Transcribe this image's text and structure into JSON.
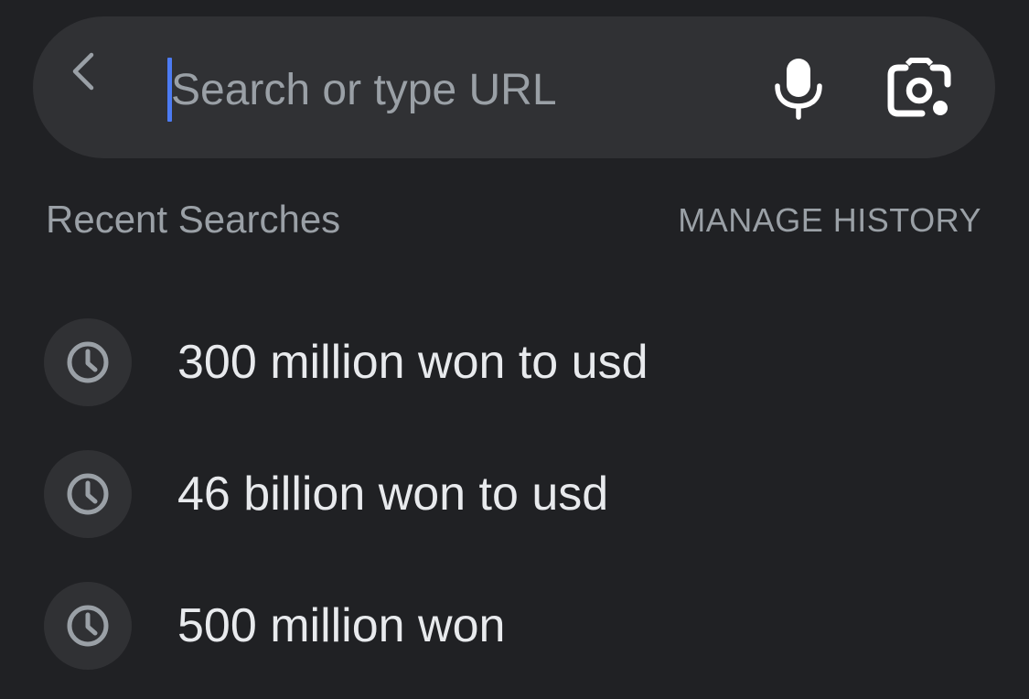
{
  "colors": {
    "background": "#202124",
    "surface": "#303134",
    "text_primary": "#e8eaed",
    "text_secondary": "#9aa0a6",
    "accent_cursor": "#4c7bf3"
  },
  "search_bar": {
    "back_icon": "chevron-left-icon",
    "placeholder": "Search or type URL",
    "value": "",
    "voice_icon": "microphone-icon",
    "lens_icon": "google-lens-icon"
  },
  "recent": {
    "title": "Recent Searches",
    "manage_label": "MANAGE HISTORY",
    "item_icon": "clock-icon",
    "items": [
      {
        "label": "300 million won to usd"
      },
      {
        "label": "46 billion won to usd"
      },
      {
        "label": "500 million won"
      }
    ]
  }
}
